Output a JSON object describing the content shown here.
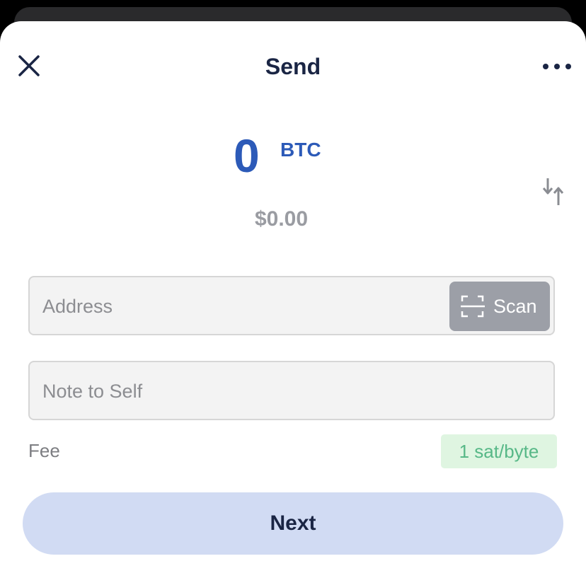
{
  "header": {
    "title": "Send"
  },
  "icons": {
    "close": "close-icon",
    "more": "more-horizontal-icon",
    "swap": "swap-vertical-icon",
    "scan": "scan-frame-icon"
  },
  "amount": {
    "value": "0",
    "unit": "BTC",
    "fiat": "$0.00"
  },
  "address_field": {
    "placeholder": "Address",
    "value": "",
    "scan_label": "Scan"
  },
  "note_field": {
    "placeholder": "Note to Self",
    "value": ""
  },
  "fee": {
    "label": "Fee",
    "value": "1 sat/byte"
  },
  "footer": {
    "next_label": "Next"
  },
  "colors": {
    "accent": "#2c5ab8",
    "title": "#1a2544",
    "fee_text": "#57b887",
    "fee_bg": "#dff5e1",
    "next_bg": "#d1dbf3",
    "scan_bg": "#9c9fa7"
  }
}
